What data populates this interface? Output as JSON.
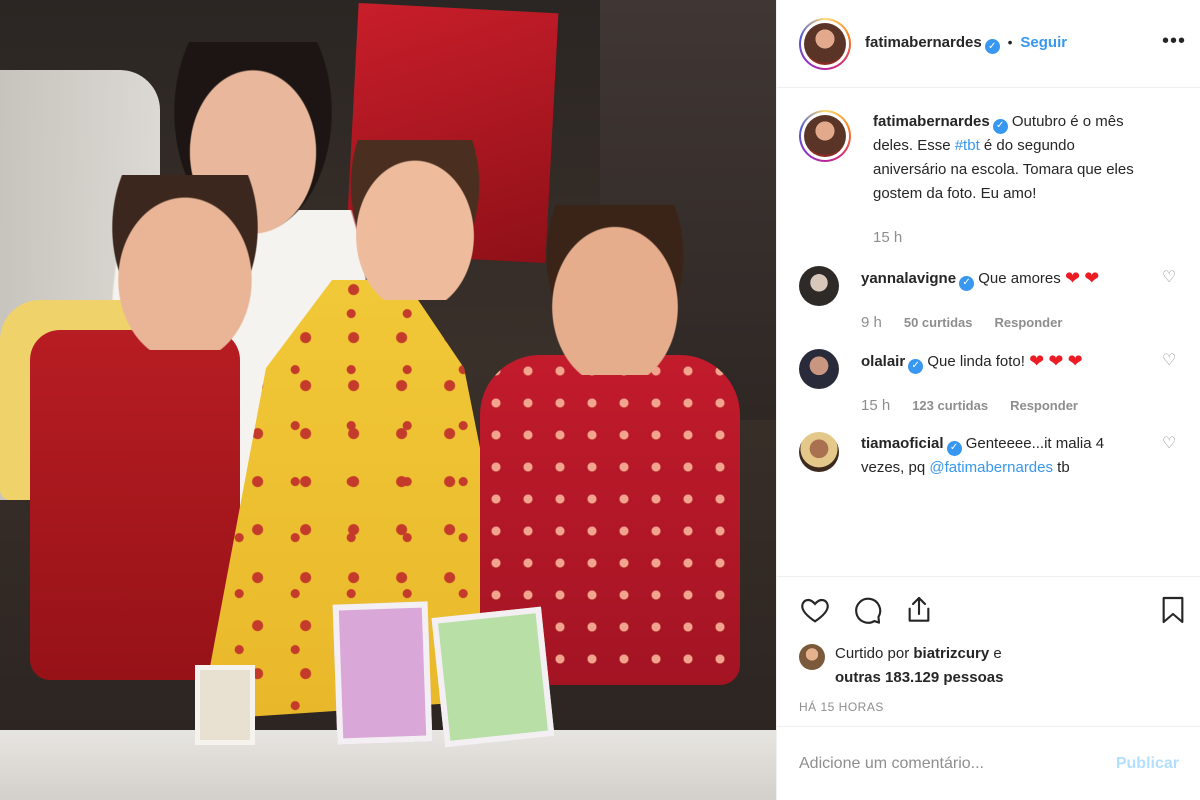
{
  "post": {
    "author": "fatimabernardes",
    "follow_label": "Seguir",
    "separator": "•",
    "more_label": "•••"
  },
  "caption": {
    "username": "fatimabernardes",
    "text_before": "Outubro é o mês deles. Esse ",
    "hashtag": "#tbt",
    "text_after": " é do segundo aniversário na escola. Tomara que eles gostem da foto. Eu amo!",
    "time": "15 h"
  },
  "comments": [
    {
      "username": "yannalavigne",
      "text": "Que amores",
      "time": "9 h",
      "likes": "50 curtidas",
      "reply": "Responder",
      "hearts": 2
    },
    {
      "username": "olalair",
      "text": "Que linda foto!",
      "time": "15 h",
      "likes": "123 curtidas",
      "reply": "Responder",
      "hearts": 3
    },
    {
      "username": "tiamaoficial",
      "text_before": "Genteeee...it malia 4 vezes, pq ",
      "mention": "@fatimabernardes",
      "text_after": " tb"
    }
  ],
  "likes": {
    "prefix": "Curtido por",
    "user": "biatrizcury",
    "conj": "e",
    "others": "outras 183.129 pessoas"
  },
  "posted_ago": "HÁ 15 HORAS",
  "add_comment": {
    "placeholder": "Adicione um comentário...",
    "publish": "Publicar"
  },
  "icons": {
    "heart": "heart-icon",
    "comment": "comment-icon",
    "share": "share-icon",
    "bookmark": "bookmark-icon",
    "verified": "verified-icon"
  },
  "colors": {
    "link": "#3897f0",
    "muted": "#8e8e8e",
    "text": "#262626",
    "publish_disabled": "#b2dffc"
  }
}
